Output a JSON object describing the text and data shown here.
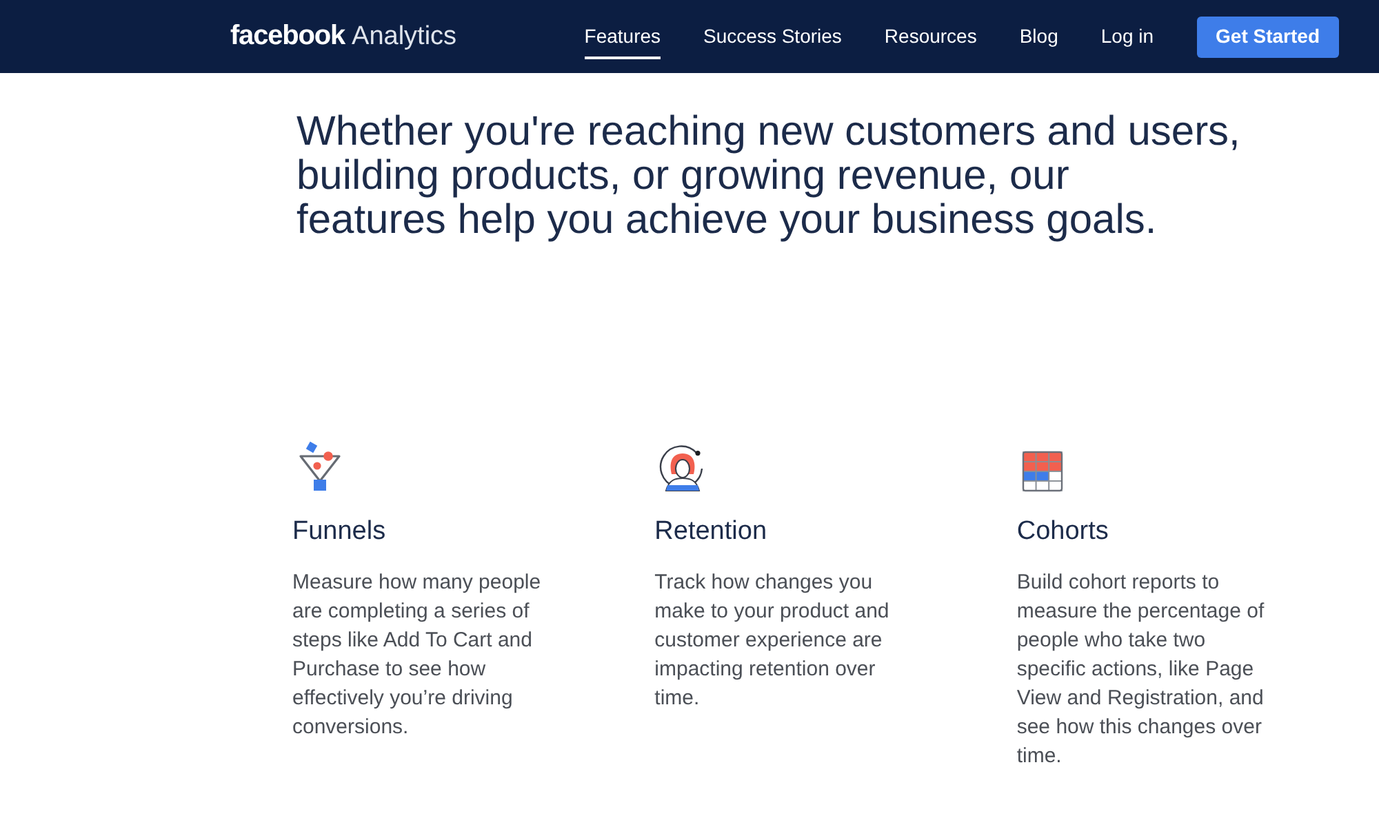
{
  "navbar": {
    "logo": {
      "brand": "facebook",
      "product": "Analytics"
    },
    "links": [
      {
        "label": "Features",
        "selected": true
      },
      {
        "label": "Success Stories",
        "selected": false
      },
      {
        "label": "Resources",
        "selected": false
      },
      {
        "label": "Blog",
        "selected": false
      },
      {
        "label": "Log in",
        "selected": false
      }
    ],
    "button": "Get Started"
  },
  "headline": {
    "lines": [
      "Whether you're reaching new customers and users,",
      "building products, or growing revenue, our",
      "features help you achieve your business goals."
    ]
  },
  "features": [
    {
      "kind": "funnel",
      "title": "Funnels",
      "description": "Measure how many people are completing a series of steps like Add To Cart and Purchase to see how effectively you’re driving conversions."
    },
    {
      "kind": "retention",
      "title": "Retention",
      "description": "Track how changes you make to your product and customer experience are impacting retention over time."
    },
    {
      "kind": "cohorts",
      "title": "Cohorts",
      "description": "Build cohort reports to measure the percentage of people who take two specific actions, like Page View and Registration, and see how this changes over time."
    }
  ]
}
